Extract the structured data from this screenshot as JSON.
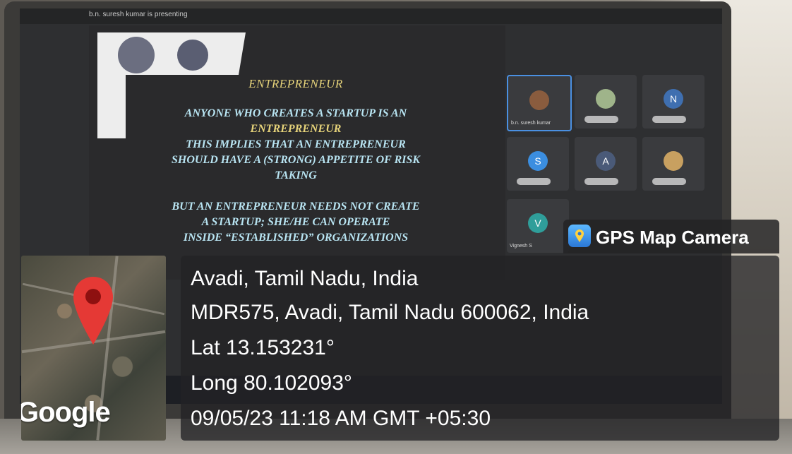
{
  "meeting": {
    "presenting_banner": "b.n. suresh kumar is presenting"
  },
  "slide": {
    "title": "ENTREPRENEUR",
    "lines": [
      "ANYONE WHO CREATES A STARTUP IS AN",
      "ENTREPRENEUR",
      "THIS IMPLIES THAT AN ENTREPRENEUR",
      "SHOULD HAVE A (STRONG) APPETITE OF RISK",
      "TAKING"
    ],
    "lines2": [
      "BUT AN ENTREPRENEUR NEEDS NOT CREATE",
      "A STARTUP; SHE/HE CAN OPERATE",
      "INSIDE “ESTABLISHED” ORGANIZATIONS"
    ]
  },
  "participants": [
    {
      "name": "b.n. suresh kumar",
      "initial": ""
    },
    {
      "name": "",
      "initial": ""
    },
    {
      "name": "",
      "initial": "N"
    },
    {
      "name": "",
      "initial": "S"
    },
    {
      "name": "",
      "initial": "A"
    },
    {
      "name": "",
      "initial": ""
    },
    {
      "name": "Vignesh S",
      "initial": "V"
    }
  ],
  "stamp": {
    "app_name": "GPS Map Camera",
    "map_brand": "Google",
    "location_title": "Avadi, Tamil Nadu, India",
    "address": "MDR575, Avadi, Tamil Nadu 600062, India",
    "latitude": "Lat 13.153231°",
    "longitude": "Long 80.102093°",
    "datetime": "09/05/23 11:18 AM GMT +05:30"
  },
  "colors": {
    "pin": "#e53935",
    "slide_title": "#e6d37a",
    "slide_body": "#b8e4f2",
    "active_tile_border": "#4a90e2"
  }
}
